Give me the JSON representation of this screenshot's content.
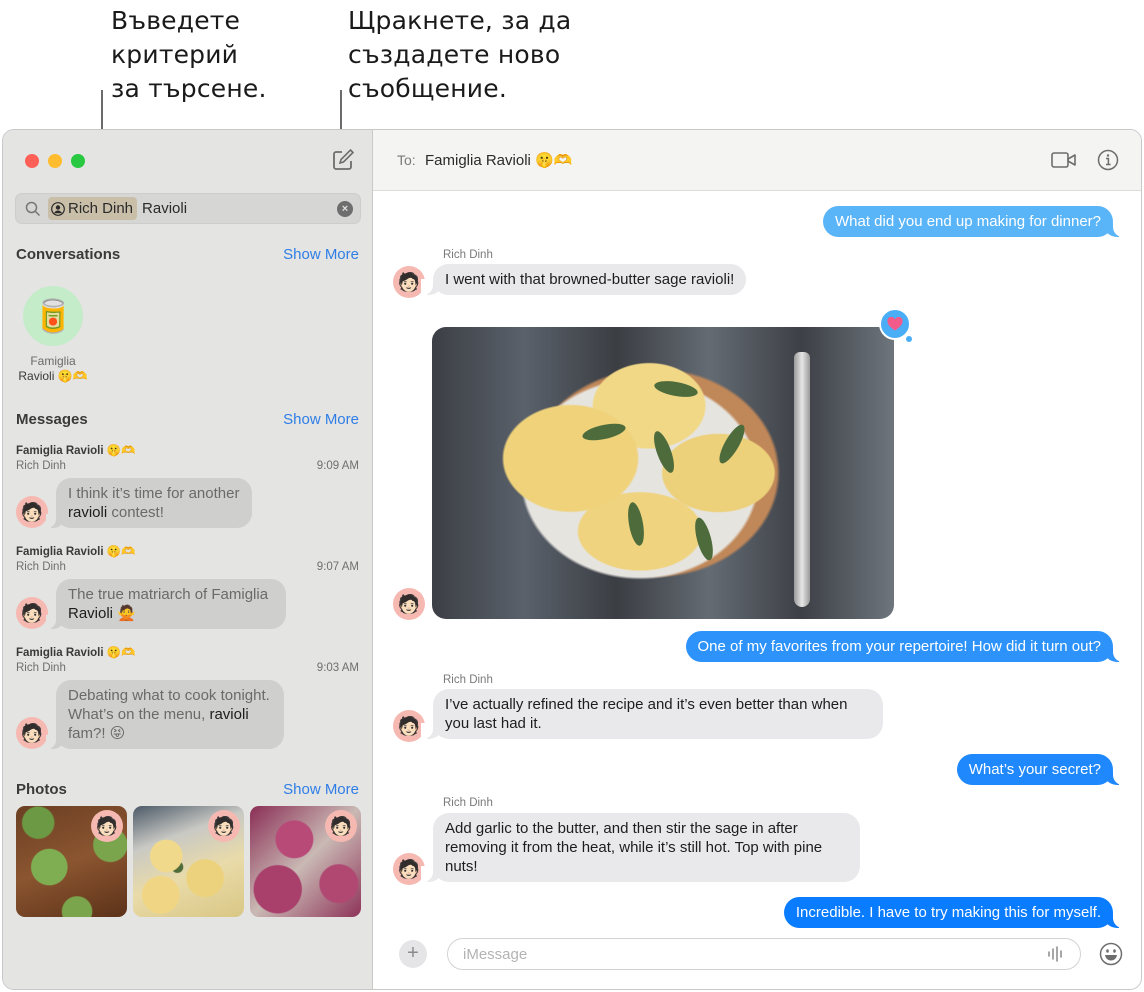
{
  "callouts": {
    "search": [
      "Въведете",
      "критерий",
      "за търсене."
    ],
    "compose": [
      "Щракнете, за да",
      "създадете ново",
      "съобщение."
    ]
  },
  "sidebar": {
    "search": {
      "token": "Rich Dinh",
      "query": "Ravioli",
      "clear_icon": "×"
    },
    "conversations": {
      "title": "Conversations",
      "show_more": "Show More",
      "items": [
        {
          "name_line1": "Famiglia",
          "name_line2": "Ravioli 🤫🫶",
          "avatar_emoji": "🥫"
        }
      ]
    },
    "messages": {
      "title": "Messages",
      "show_more": "Show More",
      "items": [
        {
          "conversation": "Famiglia Ravioli 🤫🫶",
          "sender": "Rich Dinh",
          "time": "9:09 AM",
          "text_before": "I think it’s time for another ",
          "highlight": "ravioli",
          "text_after": " contest!"
        },
        {
          "conversation": "Famiglia Ravioli 🤫🫶",
          "sender": "Rich Dinh",
          "time": "9:07 AM",
          "text_before": "The true matriarch of Famiglia ",
          "highlight": "Ravioli",
          "text_after": " 🙅"
        },
        {
          "conversation": "Famiglia Ravioli 🤫🫶",
          "sender": "Rich Dinh",
          "time": "9:03 AM",
          "text_before": "Debating what to cook tonight. What’s on the menu, ",
          "highlight": "ravioli",
          "text_after": " fam?! 😝"
        }
      ]
    },
    "photos": {
      "title": "Photos",
      "show_more": "Show More",
      "items": [
        "green ravioli on wooden board",
        "ravioli with sage",
        "beet ravioli"
      ]
    }
  },
  "chat": {
    "to_label": "To:",
    "recipient": "Famiglia Ravioli 🤫🫶",
    "avatar_emoji": "🧑🏻",
    "messages": [
      {
        "direction": "out",
        "text": "What did you end up making for dinner?"
      },
      {
        "direction": "in",
        "sender": "Rich Dinh",
        "text": "I went with that browned-butter sage ravioli!"
      },
      {
        "direction": "in",
        "type": "photo",
        "description": "browned-butter sage ravioli on a plate",
        "tapback": "heart"
      },
      {
        "direction": "out",
        "text": "One of my favorites from your repertoire! How did it turn out?"
      },
      {
        "direction": "in",
        "sender": "Rich Dinh",
        "text": "I’ve actually refined the recipe and it’s even better than when you last had it."
      },
      {
        "direction": "out",
        "text": "What’s your secret?"
      },
      {
        "direction": "in",
        "sender": "Rich Dinh",
        "text": "Add garlic to the butter, and then stir the sage in after removing it from the heat, while it’s still hot. Top with pine nuts!"
      },
      {
        "direction": "out",
        "text": "Incredible. I have to try making this for myself."
      }
    ],
    "composer": {
      "placeholder": "iMessage",
      "value": ""
    }
  },
  "colors": {
    "accent": "#2f7ee6",
    "bubble_out_light": "#5ab4f8",
    "bubble_out_mid": "#2d93fb",
    "bubble_out_strong": "#0a7cff",
    "bubble_in": "#e9e9eb",
    "tapback": "#4aaef6",
    "heart": "#f25a8a"
  }
}
